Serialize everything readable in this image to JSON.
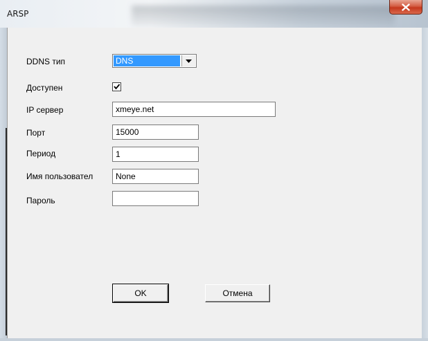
{
  "window": {
    "title": "ARSP",
    "close_glyph": "x"
  },
  "form": {
    "ddns_type": {
      "label": "DDNS тип",
      "value": "DNS"
    },
    "enabled": {
      "label": "Доступен",
      "checked": true
    },
    "ip_server": {
      "label": "IP сервер",
      "value": "xmeye.net"
    },
    "port": {
      "label": "Порт",
      "value": "15000"
    },
    "period": {
      "label": "Период",
      "value": "1"
    },
    "username": {
      "label": "Имя пользовател",
      "value": "None"
    },
    "password": {
      "label": "Пароль",
      "value": ""
    }
  },
  "buttons": {
    "ok_label": "OK",
    "cancel_label": "Отмена"
  },
  "colors": {
    "selection": "#3399ff",
    "close_button": "#c5381d"
  },
  "icons": {
    "close": "close-icon",
    "dropdown": "chevron-down-icon",
    "check": "check-icon"
  }
}
